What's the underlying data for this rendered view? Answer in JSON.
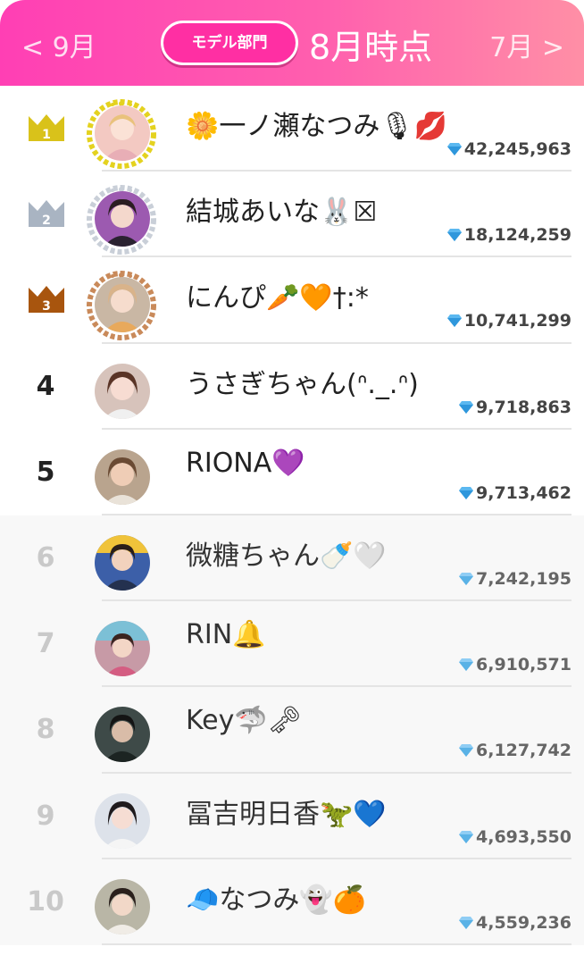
{
  "header": {
    "prev_label": "< 9月",
    "next_label": "7月 >",
    "department": "モデル部門",
    "period": "8月時点"
  },
  "colors": {
    "header_start": "#ff3fb4",
    "header_end": "#ff8fa6",
    "gold": "#d9c21a",
    "silver": "#a9b4c2",
    "bronze": "#a8550e"
  },
  "rankings": [
    {
      "rank": "1",
      "name": "🌼一ノ瀬なつみ🎙💋",
      "score": "42,245,963",
      "crown": "gold"
    },
    {
      "rank": "2",
      "name": "結城あいな🐰☒",
      "score": "18,124,259",
      "crown": "silver"
    },
    {
      "rank": "3",
      "name": "にんぴ🥕🧡†:*",
      "score": "10,741,299",
      "crown": "bronze"
    },
    {
      "rank": "4",
      "name": "うさぎちゃん(ᐢ._.ᐢ)",
      "score": "9,718,863"
    },
    {
      "rank": "5",
      "name": "RIONA💜",
      "score": "9,713,462"
    },
    {
      "rank": "6",
      "name": "微糖ちゃん🍼🤍",
      "score": "7,242,195"
    },
    {
      "rank": "7",
      "name": "RIN🔔",
      "score": "6,910,571"
    },
    {
      "rank": "8",
      "name": "Key🦈🗝",
      "score": "6,127,742"
    },
    {
      "rank": "9",
      "name": "冨吉明日香🦖💙",
      "score": "4,693,550"
    },
    {
      "rank": "10",
      "name": "🧢なつみ👻🍊",
      "score": "4,559,236"
    }
  ]
}
